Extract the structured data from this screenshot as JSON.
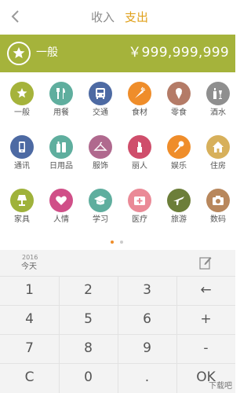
{
  "header": {
    "tabs": [
      {
        "label": "收入",
        "active": false
      },
      {
        "label": "支出",
        "active": true
      }
    ],
    "active_color": "#e0a11b"
  },
  "banner": {
    "category": "一般",
    "amount": "￥999,999,999",
    "bg_color": "#a5b33b"
  },
  "categories": [
    {
      "label": "一般",
      "icon": "star-icon",
      "color": "#a5b33b"
    },
    {
      "label": "用餐",
      "icon": "cutlery-icon",
      "color": "#5fae9e"
    },
    {
      "label": "交通",
      "icon": "bus-icon",
      "color": "#4d6aa3"
    },
    {
      "label": "食材",
      "icon": "carrot-icon",
      "color": "#ef8d2a"
    },
    {
      "label": "零食",
      "icon": "ice-cream-icon",
      "color": "#b47b67"
    },
    {
      "label": "酒水",
      "icon": "bottle-icon",
      "color": "#8f8f8f"
    },
    {
      "label": "通讯",
      "icon": "phone-icon",
      "color": "#4d6aa3"
    },
    {
      "label": "日用品",
      "icon": "toiletries-icon",
      "color": "#5fae9e"
    },
    {
      "label": "服饰",
      "icon": "hanger-icon",
      "color": "#b0698e"
    },
    {
      "label": "丽人",
      "icon": "lipstick-icon",
      "color": "#cf4e6b"
    },
    {
      "label": "娱乐",
      "icon": "microphone-icon",
      "color": "#ef8d2a"
    },
    {
      "label": "住房",
      "icon": "house-icon",
      "color": "#d7b05b"
    },
    {
      "label": "家具",
      "icon": "lamp-icon",
      "color": "#9fb23b"
    },
    {
      "label": "人情",
      "icon": "gift-heart-icon",
      "color": "#d04f88"
    },
    {
      "label": "学习",
      "icon": "graduation-cap-icon",
      "color": "#5fae9e"
    },
    {
      "label": "医疗",
      "icon": "first-aid-icon",
      "color": "#ea8a97"
    },
    {
      "label": "旅游",
      "icon": "airplane-icon",
      "color": "#6c7e39"
    },
    {
      "label": "数码",
      "icon": "camera-icon",
      "color": "#b8875c"
    }
  ],
  "pager": {
    "pages": 2,
    "current": 1,
    "active_color": "#ef8d2a",
    "inactive_color": "#cccccc"
  },
  "date": {
    "year": "2016",
    "label": "今天"
  },
  "keypad": [
    [
      "1",
      "2",
      "3",
      "←"
    ],
    [
      "4",
      "5",
      "6",
      "+"
    ],
    [
      "7",
      "8",
      "9",
      "-"
    ],
    [
      "C",
      "0",
      ".",
      "OK"
    ]
  ],
  "watermark": "下载吧"
}
